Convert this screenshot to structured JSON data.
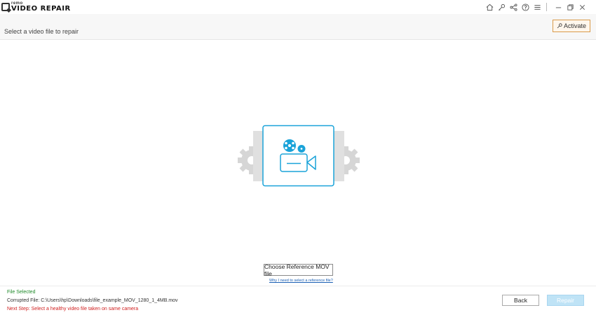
{
  "app": {
    "logo_small": "remo",
    "logo_big": "VIDEO REPAIR"
  },
  "titlebar": {
    "icons": [
      "home-icon",
      "key-icon",
      "share-icon",
      "help-icon",
      "menu-icon"
    ],
    "window_controls": [
      "minimize-icon",
      "restore-icon",
      "close-icon"
    ]
  },
  "header": {
    "title": "Select a video file to repair",
    "activate_label": "Activate"
  },
  "main": {
    "choose_reference_label": "Choose Reference MOV file",
    "why_link": "Why I need to select a reference file?"
  },
  "footer": {
    "status_selected": "File Selected",
    "corrupted_file": "Corrupted File: C:\\Users\\hp\\Downloads\\file_example_MOV_1280_1_4MB.mov",
    "next_step": "Next Step: Select a healthy video file taken on same camera",
    "back_label": "Back",
    "repair_label": "Repair"
  },
  "colors": {
    "accent": "#1aa3d9",
    "activate_border": "#d99a4a",
    "status_green": "#1f8a2a",
    "status_red": "#d02020",
    "repair_disabled": "#bfe3f6"
  }
}
